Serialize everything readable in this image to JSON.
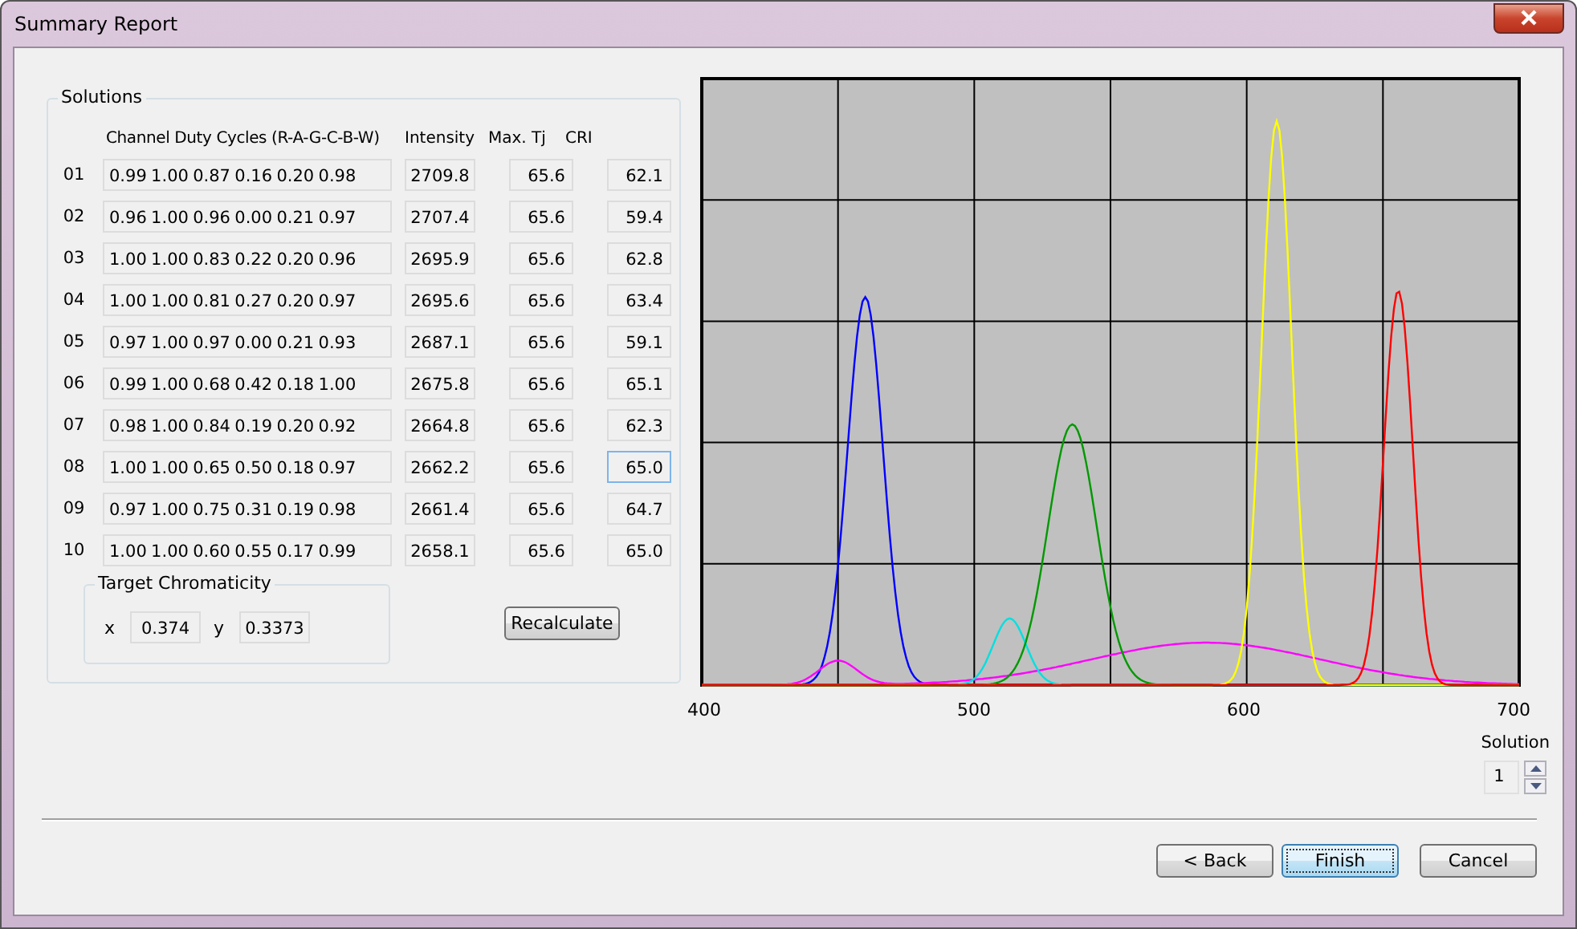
{
  "window": {
    "title": "Summary Report"
  },
  "solutions": {
    "title": "Solutions",
    "headers": [
      "Channel Duty Cycles (R-A-G-C-B-W)",
      "Intensity",
      "Max. Tj",
      "CRI"
    ],
    "rows": [
      {
        "index": "01",
        "duty": "0.99  1.00  0.87  0.16  0.20  0.98",
        "intensity": "2709.8",
        "max_tj": "65.6",
        "cri": "62.1",
        "focused": false
      },
      {
        "index": "02",
        "duty": "0.96  1.00  0.96  0.00  0.21  0.97",
        "intensity": "2707.4",
        "max_tj": "65.6",
        "cri": "59.4",
        "focused": false
      },
      {
        "index": "03",
        "duty": "1.00  1.00  0.83  0.22  0.20  0.96",
        "intensity": "2695.9",
        "max_tj": "65.6",
        "cri": "62.8",
        "focused": false
      },
      {
        "index": "04",
        "duty": "1.00  1.00  0.81  0.27  0.20  0.97",
        "intensity": "2695.6",
        "max_tj": "65.6",
        "cri": "63.4",
        "focused": false
      },
      {
        "index": "05",
        "duty": "0.97  1.00  0.97  0.00  0.21  0.93",
        "intensity": "2687.1",
        "max_tj": "65.6",
        "cri": "59.1",
        "focused": false
      },
      {
        "index": "06",
        "duty": "0.99  1.00  0.68  0.42  0.18  1.00",
        "intensity": "2675.8",
        "max_tj": "65.6",
        "cri": "65.1",
        "focused": false
      },
      {
        "index": "07",
        "duty": "0.98  1.00  0.84  0.19  0.20  0.92",
        "intensity": "2664.8",
        "max_tj": "65.6",
        "cri": "62.3",
        "focused": false
      },
      {
        "index": "08",
        "duty": "1.00  1.00  0.65  0.50  0.18  0.97",
        "intensity": "2662.2",
        "max_tj": "65.6",
        "cri": "65.0",
        "focused": true
      },
      {
        "index": "09",
        "duty": "0.97  1.00  0.75  0.31  0.19  0.98",
        "intensity": "2661.4",
        "max_tj": "65.6",
        "cri": "64.7",
        "focused": false
      },
      {
        "index": "10",
        "duty": "1.00  1.00  0.60  0.55  0.17  0.99",
        "intensity": "2658.1",
        "max_tj": "65.6",
        "cri": "65.0",
        "focused": false
      }
    ],
    "target": {
      "title": "Target Chromaticity",
      "x_label": "x",
      "x_value": "0.374",
      "y_label": "y",
      "y_value": "0.3373"
    },
    "recalculate": "Recalculate"
  },
  "spectrum": {
    "x_ticks": [
      "400",
      "500",
      "600",
      "700"
    ]
  },
  "solution_picker": {
    "label": "Solution",
    "value": "1"
  },
  "buttons": [
    {
      "label": "< Back",
      "default": false
    },
    {
      "label": "Finish",
      "default": true
    },
    {
      "label": "Cancel",
      "default": false
    }
  ]
}
